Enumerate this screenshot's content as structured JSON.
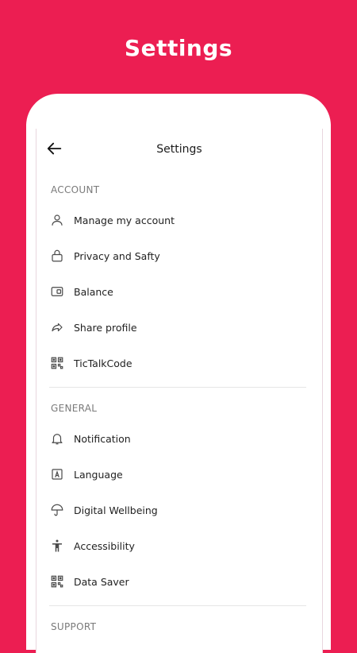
{
  "banner": {
    "title": "Settings"
  },
  "topbar": {
    "title": "Settings"
  },
  "sections": {
    "account": {
      "label": "ACCOUNT",
      "items": [
        {
          "label": "Manage my account",
          "icon": "person-icon"
        },
        {
          "label": "Privacy and Safty",
          "icon": "lock-icon"
        },
        {
          "label": "Balance",
          "icon": "wallet-icon"
        },
        {
          "label": "Share profile",
          "icon": "share-icon"
        },
        {
          "label": "TicTalkCode",
          "icon": "qr-code-icon"
        }
      ]
    },
    "general": {
      "label": "GENERAL",
      "items": [
        {
          "label": "Notification",
          "icon": "bell-icon"
        },
        {
          "label": "Language",
          "icon": "language-icon"
        },
        {
          "label": "Digital Wellbeing",
          "icon": "umbrella-icon"
        },
        {
          "label": "Accessibility",
          "icon": "accessibility-icon"
        },
        {
          "label": "Data Saver",
          "icon": "qr-code-icon"
        }
      ]
    },
    "support": {
      "label": "SUPPORT"
    }
  },
  "colors": {
    "brand": "#EC1E52",
    "icon": "#4a4a4a"
  }
}
